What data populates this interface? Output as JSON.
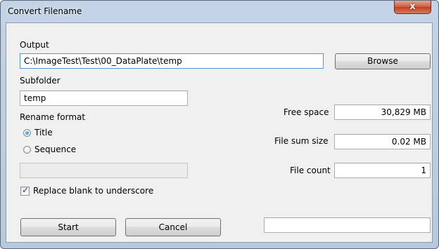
{
  "window": {
    "title": "Convert Filename",
    "close_glyph": "x"
  },
  "output": {
    "label": "Output",
    "value": "C:\\ImageTest\\Test\\00_DataPlate\\temp",
    "browse_label": "Browse"
  },
  "subfolder": {
    "label": "Subfolder",
    "value": "temp"
  },
  "rename_format": {
    "label": "Rename format",
    "options": [
      {
        "label": "Title",
        "selected": true
      },
      {
        "label": "Sequence",
        "selected": false
      }
    ],
    "pattern_value": ""
  },
  "replace_blank": {
    "label": "Replace blank to underscore",
    "checked": true,
    "mark": "✓"
  },
  "stats": {
    "free_space_label": "Free space",
    "free_space_value": "30,829 MB",
    "file_sum_label": "File sum size",
    "file_sum_value": "0.02 MB",
    "file_count_label": "File count",
    "file_count_value": "1"
  },
  "actions": {
    "start_label": "Start",
    "cancel_label": "Cancel",
    "status_value": ""
  }
}
